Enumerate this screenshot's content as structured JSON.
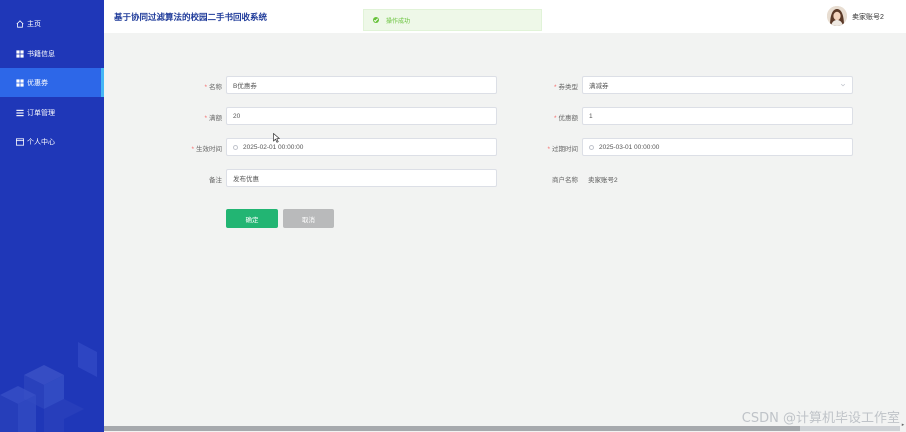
{
  "header": {
    "app_title": "基于协同过滤算法的校园二手书回收系统",
    "toast_message": "操作成功",
    "user_name": "卖家账号2"
  },
  "sidebar": {
    "items": [
      {
        "label": "主页",
        "icon": "home-icon"
      },
      {
        "label": "书籍信息",
        "icon": "grid-icon"
      },
      {
        "label": "优惠券",
        "icon": "grid-icon",
        "active": true
      },
      {
        "label": "订单管理",
        "icon": "list-icon"
      },
      {
        "label": "个人中心",
        "icon": "window-icon"
      }
    ]
  },
  "form": {
    "name_label": "名称",
    "name_value": "B优惠券",
    "coupon_type_label": "券类型",
    "coupon_type_value": "满减券",
    "threshold_label": "满额",
    "threshold_value": "20",
    "discount_label": "优惠额",
    "discount_value": "1",
    "start_time_label": "生效时间",
    "start_time_value": "2025-02-01 00:00:00",
    "end_time_label": "过期时间",
    "end_time_value": "2025-03-01 00:00:00",
    "remark_label": "备注",
    "remark_value": "发布优惠",
    "merchant_label": "商户名称",
    "merchant_value": "卖家账号2",
    "confirm_label": "确定",
    "cancel_label": "取消"
  },
  "watermark": "CSDN @计算机毕设工作室",
  "colors": {
    "sidebar_bg": "#1f37b8",
    "sidebar_active": "#2d67e8",
    "confirm_button": "#22b573",
    "cancel_button": "#b9babb",
    "toast_success": "#67c23a"
  }
}
